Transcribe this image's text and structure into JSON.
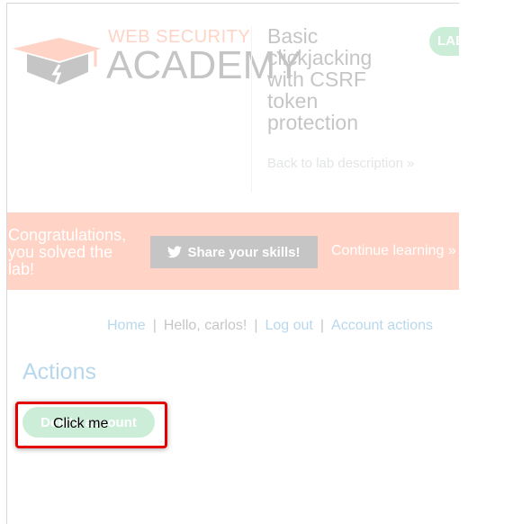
{
  "logo": {
    "top_text": "WEB SECURITY",
    "main_text": "ACADEMY",
    "icon": "graduation-cap-icon"
  },
  "lab": {
    "title": "Basic clickjacking with CSRF token protection",
    "back_link": "Back to lab description »",
    "badge": "LAB"
  },
  "banner": {
    "message": "Congratulations, you solved the lab!",
    "share_label": "Share your skills!",
    "share_icon": "twitter-bird-icon",
    "continue_label": "Continue learning »"
  },
  "nav": {
    "home": "Home",
    "greeting": "Hello, carlos!",
    "logout": "Log out",
    "account_actions": "Account actions"
  },
  "actions": {
    "heading": "Actions",
    "delete_label": "Delete account"
  },
  "decoy": {
    "label": "Click me"
  },
  "colors": {
    "accent_orange": "#ff6633",
    "link_blue": "#0071bc",
    "button_green": "#4cc47a",
    "decoy_border": "#e30000"
  }
}
